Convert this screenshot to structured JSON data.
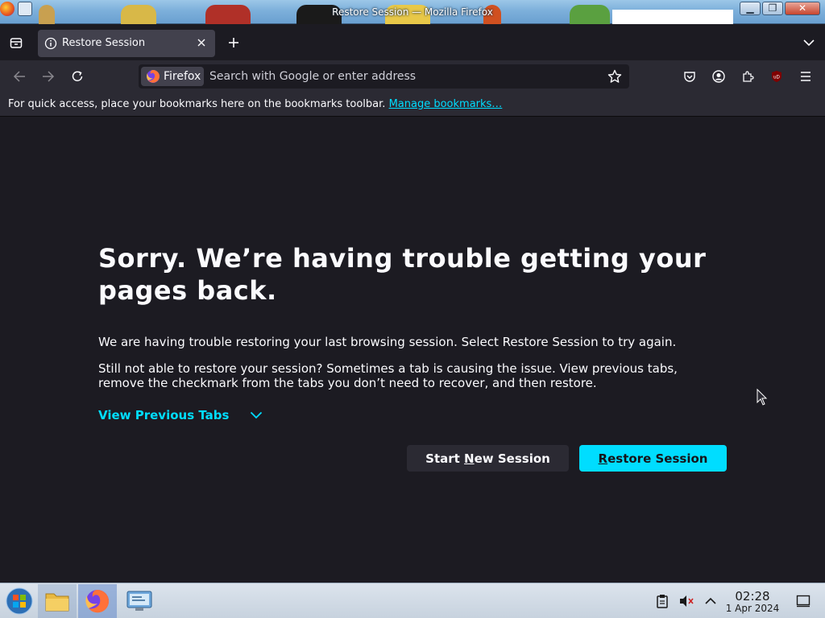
{
  "window": {
    "title": "Restore Session — Mozilla Firefox",
    "minimize_label": "▁",
    "maximize_label": "❐",
    "close_label": "✕"
  },
  "tabs": [
    {
      "label": "Restore Session",
      "icon": "info-icon",
      "active": true
    }
  ],
  "navbar": {
    "identity_label": "Firefox",
    "url_placeholder": "Search with Google or enter address",
    "url_value": ""
  },
  "bookmarks_bar": {
    "message": "For quick access, place your bookmarks here on the bookmarks toolbar.",
    "link": "Manage bookmarks…"
  },
  "page": {
    "heading": "Sorry. We’re having trouble getting your pages back.",
    "paragraph1": "We are having trouble restoring your last browsing session. Select Restore Session to try again.",
    "paragraph2": "Still not able to restore your session? Sometimes a tab is causing the issue. View previous tabs, remove the checkmark from the tabs you don’t need to recover, and then restore.",
    "view_previous_tabs": "View Previous Tabs",
    "start_new_session": {
      "access_key_pre": "Start ",
      "access_key": "N",
      "post": "ew Session"
    },
    "restore_session": {
      "access_key": "R",
      "post": "estore Session"
    }
  },
  "colors": {
    "page_bg": "#1c1b22",
    "toolbar_bg": "#2b2a33",
    "accent": "#00ddff",
    "text": "#fbfbfe"
  },
  "taskbar": {
    "items": [
      "start-button",
      "file-manager",
      "firefox",
      "system-settings"
    ],
    "clock_time": "02:28",
    "clock_date": "1 Apr 2024"
  }
}
